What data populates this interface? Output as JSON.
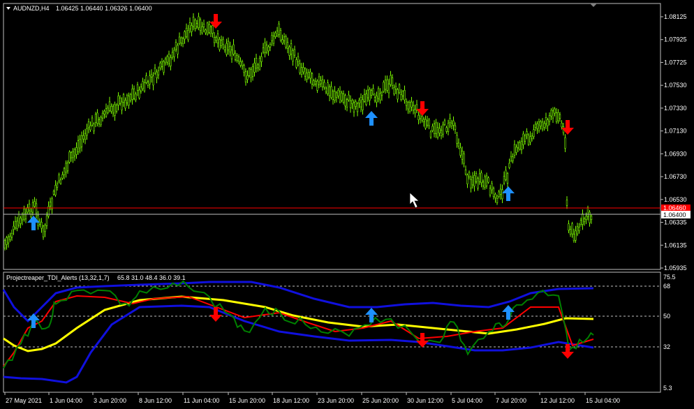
{
  "main_chart": {
    "symbol": "AUDNZD,H4",
    "ohlc": "1.06425 1.06440 1.06326 1.06400",
    "price_ticks": [
      "1.08125",
      "1.07925",
      "1.07725",
      "1.07530",
      "1.07330",
      "1.07130",
      "1.06930",
      "1.06730",
      "1.06530",
      "1.06335",
      "1.06135",
      "1.05935"
    ],
    "current_price_label": "1.06400",
    "alert_price_label": "1.06460",
    "colors": {
      "candle": "#7CFC00",
      "alert_line": "#ff0000",
      "price_line": "#c0c0c0",
      "up_arrow": "#1e90ff",
      "down_arrow": "#ff0000"
    },
    "arrows": [
      "up",
      "down",
      "up",
      "down",
      "up",
      "down"
    ]
  },
  "indicator": {
    "title": "Projectreaper_TDI_Alerts (13,32,1,7)",
    "values": "65.8 31.0 48.4 36.0 39.1",
    "levels": [
      "75.5",
      "68",
      "50",
      "32",
      "5.3"
    ],
    "colors": {
      "band": "#1010dd",
      "rsi": "#008000",
      "signal": "#ff0000",
      "mid": "#ffff00"
    }
  },
  "time_axis": [
    "27 May 2021",
    "1 Jun 04:00",
    "3 Jun 20:00",
    "8 Jun 12:00",
    "11 Jun 04:00",
    "15 Jun 20:00",
    "18 Jun 12:00",
    "23 Jun 20:00",
    "25 Jun 20:00",
    "30 Jun 12:00",
    "5 Jul 04:00",
    "7 Jul 20:00",
    "12 Jul 12:00",
    "15 Jul 04:00"
  ]
}
